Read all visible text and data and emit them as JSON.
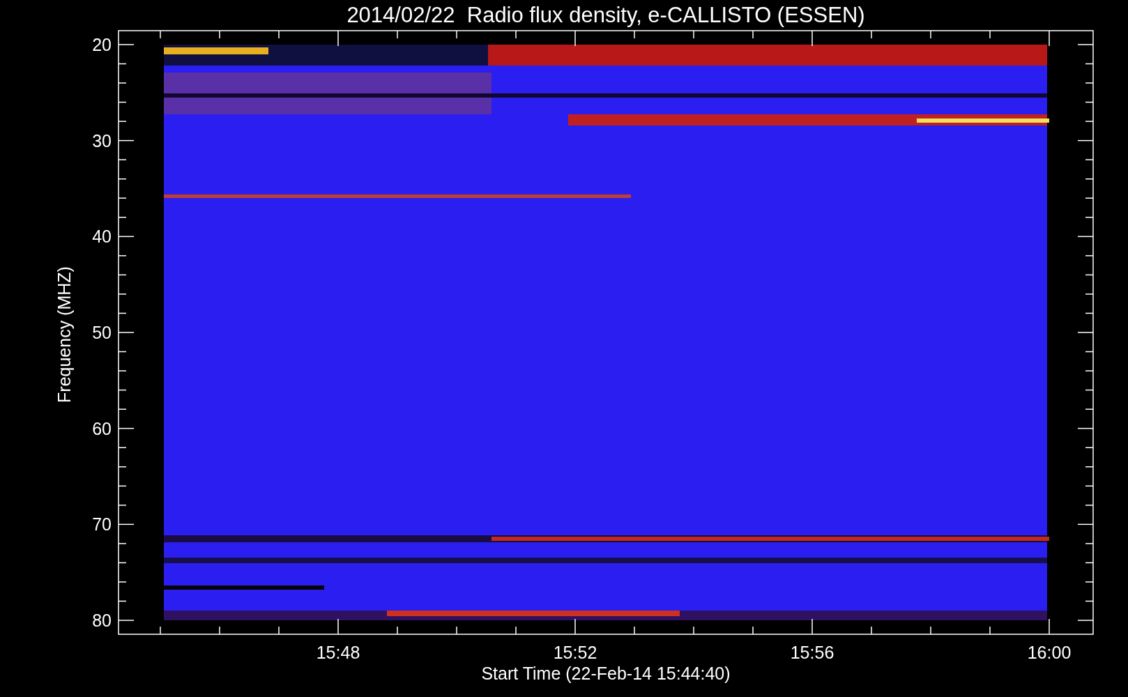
{
  "title": "2014/02/22  Radio flux density, e-CALLISTO (ESSEN)",
  "y_axis": {
    "label": "Frequency (MHZ)",
    "ticks": [
      "20",
      "30",
      "40",
      "50",
      "60",
      "70",
      "80"
    ]
  },
  "x_axis": {
    "label": "Start Time (22-Feb-14 15:44:40)",
    "ticks": [
      "15:48",
      "15:52",
      "15:56",
      "16:00"
    ]
  }
}
